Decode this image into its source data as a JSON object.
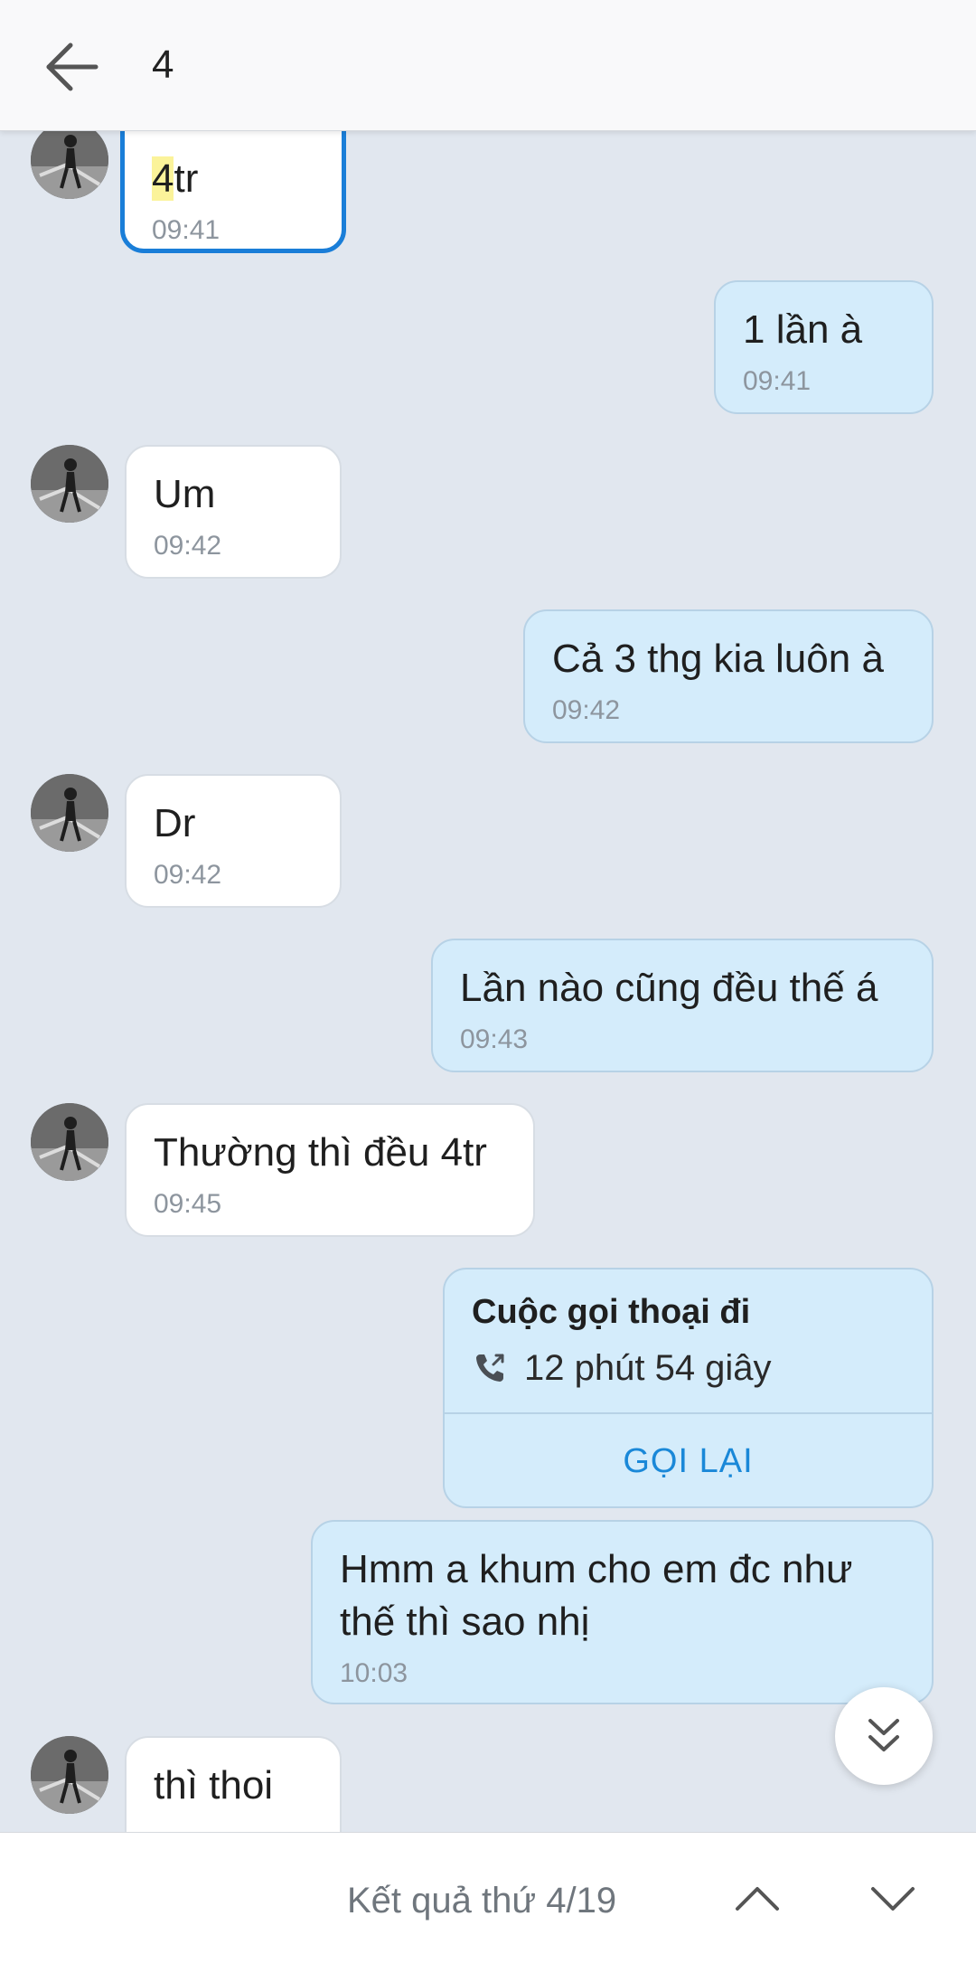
{
  "header": {
    "back_icon": "arrow-left-icon",
    "title": "4"
  },
  "messages": [
    {
      "direction": "in",
      "text_highlight": "4",
      "text_rest": "tr",
      "time": "09:41",
      "selected": true
    },
    {
      "direction": "out",
      "text": "1 lần à",
      "time": "09:41"
    },
    {
      "direction": "in",
      "text": "Um",
      "time": "09:42"
    },
    {
      "direction": "out",
      "text": "Cả 3 thg kia luôn à",
      "time": "09:42"
    },
    {
      "direction": "in",
      "text": "Dr",
      "time": "09:42"
    },
    {
      "direction": "out",
      "text": "Lần nào cũng đều thế á",
      "time": "09:43"
    },
    {
      "direction": "in",
      "text": "Thường thì đều 4tr",
      "time": "09:45"
    },
    {
      "direction": "out",
      "type": "call",
      "title": "Cuộc gọi thoại đi",
      "duration": "12 phút 54 giây",
      "action": "GỌI LẠI",
      "icon": "outgoing-call-icon"
    },
    {
      "direction": "out",
      "text": "Hmm a khum cho em đc như thế thì sao nhị",
      "time": "10:03"
    },
    {
      "direction": "in",
      "text": "thì thoi"
    }
  ],
  "scroll_button": {
    "icon": "double-chevron-down-icon"
  },
  "search_bar": {
    "result_text": "Kết quả thứ 4/19",
    "prev_icon": "chevron-up-icon",
    "next_icon": "chevron-down-icon"
  },
  "colors": {
    "background": "#e1e7ef",
    "incoming_bubble": "#ffffff",
    "outgoing_bubble": "#d4ecfb",
    "accent": "#1a7ed8",
    "highlight": "#fbf39a"
  }
}
